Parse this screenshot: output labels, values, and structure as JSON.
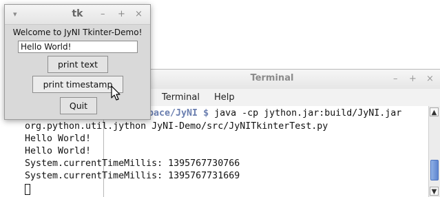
{
  "terminal": {
    "title": "Terminal",
    "window_controls": {
      "minimize": "–",
      "maximize": "+",
      "close": "×"
    },
    "menus": [
      "Terminal",
      "Help"
    ],
    "prompt_dir": "space/JyNI",
    "prompt_sign": "$",
    "command_1": " java -cp jython.jar:build/JyNI.jar",
    "lines": [
      "org.python.util.jython JyNI-Demo/src/JyNITkinterTest.py",
      "Hello World!",
      "Hello World!",
      "System.currentTimeMillis: 1395767730766",
      "System.currentTimeMillis: 1395767731669"
    ]
  },
  "tk": {
    "title": "tk",
    "menu_glyph": "▾",
    "window_controls": {
      "minimize": "–",
      "maximize": "+",
      "close": "×"
    },
    "label": "Welcome to JyNI Tkinter-Demo!",
    "entry_value": "Hello World!",
    "buttons": {
      "print_text": "print text",
      "print_timestamp": "print timestamp",
      "quit": "Quit"
    }
  },
  "icons": [
    "window-menu-icon",
    "minimize-icon",
    "maximize-icon",
    "close-icon",
    "scroll-up-icon",
    "scroll-down-icon",
    "mouse-pointer-icon"
  ]
}
